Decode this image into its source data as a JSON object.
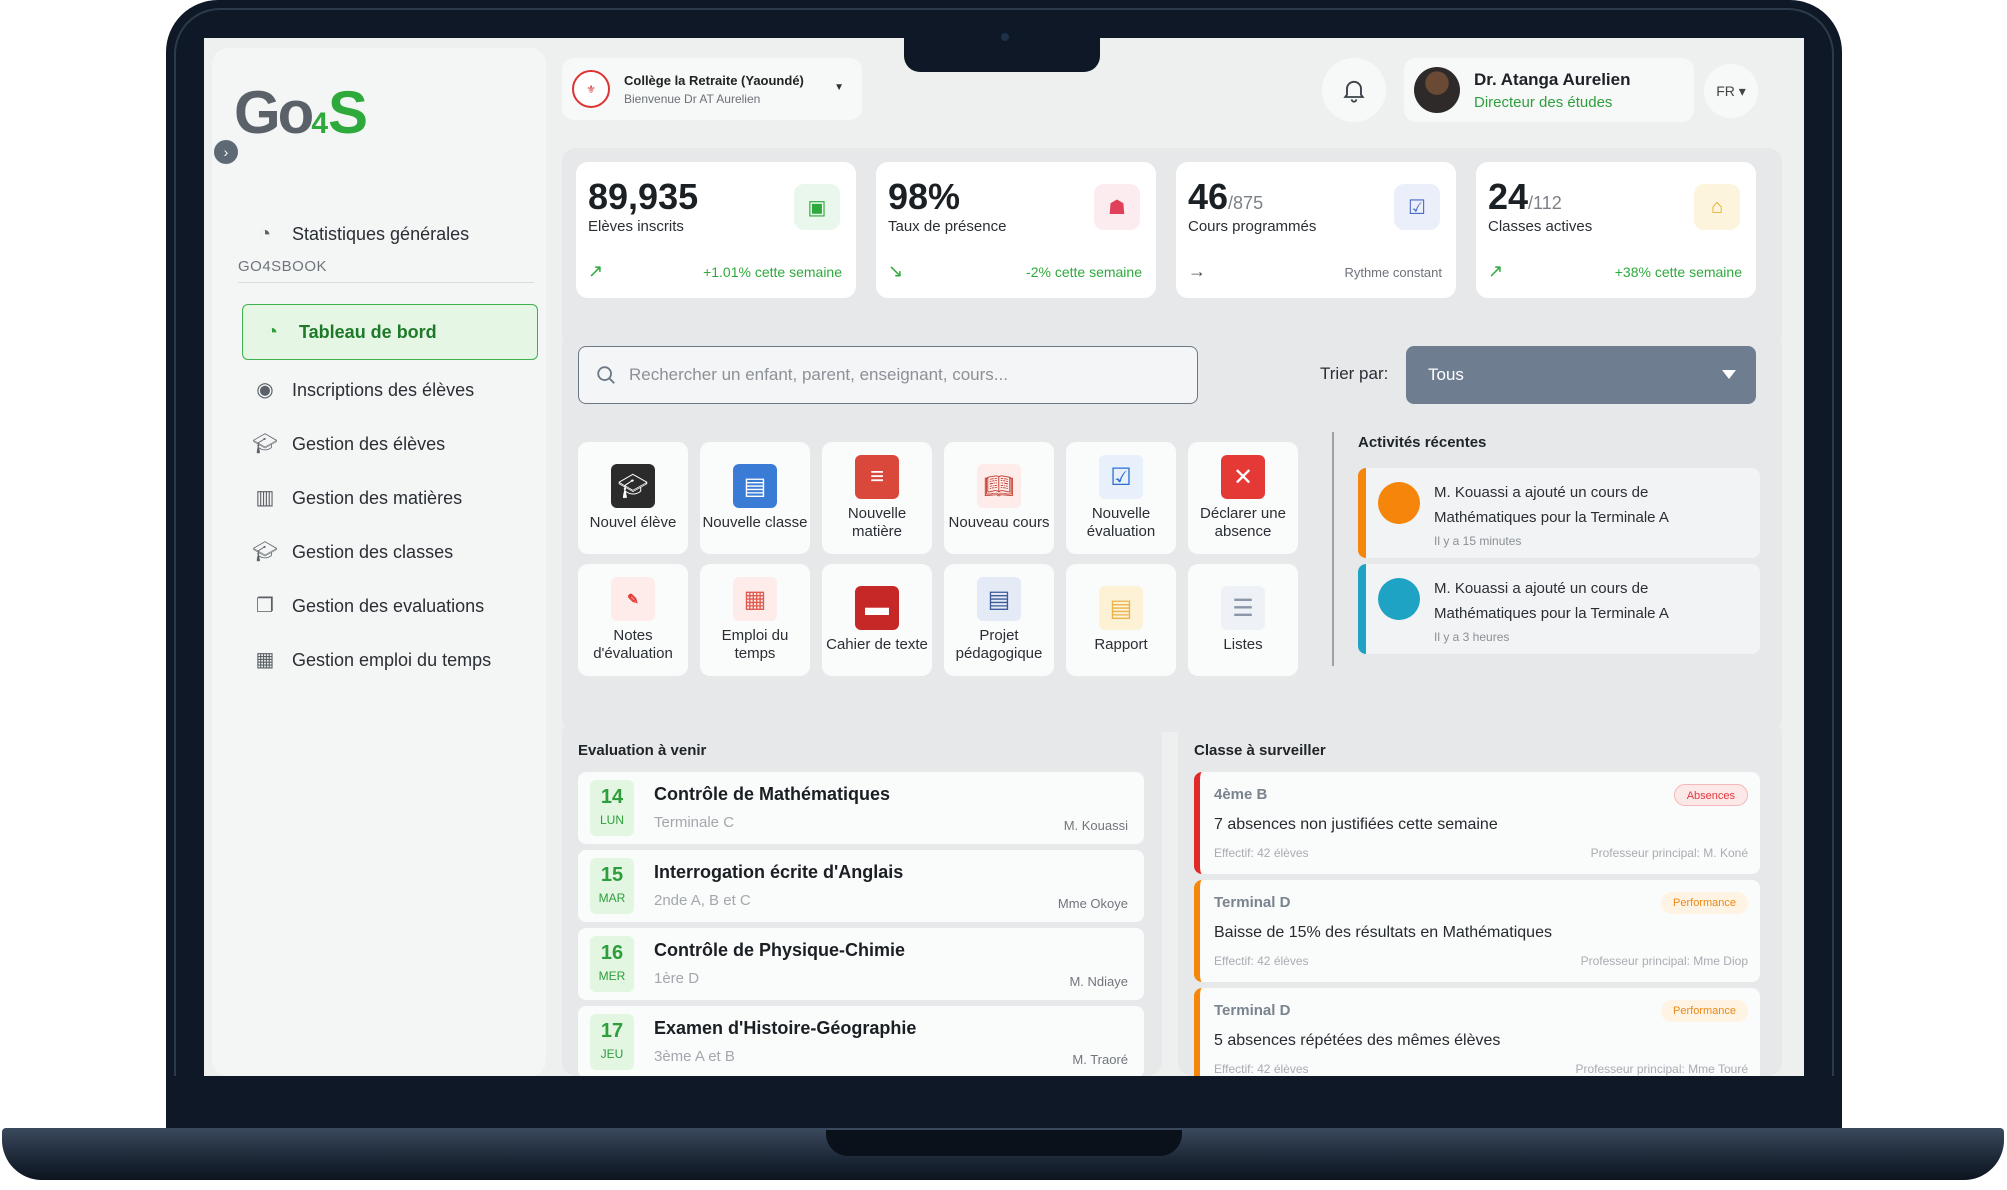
{
  "sidebar": {
    "logo": {
      "main": "Go",
      "four": "4",
      "s": "S"
    },
    "top_item": "Statistiques générales",
    "section": "GO4SBOOK",
    "items": [
      {
        "label": "Tableau de bord",
        "icon": "pie-chart-icon",
        "active": true
      },
      {
        "label": "Inscriptions des élèves",
        "icon": "user-circle-icon"
      },
      {
        "label": "Gestion des élèves",
        "icon": "graduation-cap-icon"
      },
      {
        "label": "Gestion des matières",
        "icon": "books-icon"
      },
      {
        "label": "Gestion des classes",
        "icon": "graduation-cap-icon"
      },
      {
        "label": "Gestion des evaluations",
        "icon": "copy-icon"
      },
      {
        "label": "Gestion emploi du temps",
        "icon": "calendar-icon"
      }
    ]
  },
  "header": {
    "school_name": "Collège la Retraite (Yaoundé)",
    "welcome": "Bienvenue Dr AT Aurelien",
    "user_name": "Dr. Atanga Aurelien",
    "user_role": "Directeur des études",
    "lang": "FR"
  },
  "stats": [
    {
      "value": "89,935",
      "total": "",
      "label": "Elèves inscrits",
      "trend": "+1.01% cette semaine",
      "trend_color": "#2eaa3c",
      "arrow": "↗",
      "icon": "backpack-icon",
      "icon_bg": "#eaf7ec",
      "icon_color": "#2eaa3c"
    },
    {
      "value": "98%",
      "total": "",
      "label": "Taux de présence",
      "trend": "-2% cette semaine",
      "trend_color": "#2eaa3c",
      "arrow": "↘",
      "icon": "ghost-icon",
      "icon_bg": "#fdecef",
      "icon_color": "#e0405a"
    },
    {
      "value": "46",
      "total": "/875",
      "label": "Cours programmés",
      "trend": "Rythme constant",
      "trend_color": "#6c7278",
      "arrow": "→",
      "icon": "book-check-icon",
      "icon_bg": "#ebeff9",
      "icon_color": "#4a6bc8"
    },
    {
      "value": "24",
      "total": "/112",
      "label": "Classes actives",
      "trend": "+38% cette semaine",
      "trend_color": "#2eaa3c",
      "arrow": "↗",
      "icon": "school-icon",
      "icon_bg": "#fdf4dd",
      "icon_color": "#e6a818"
    }
  ],
  "search": {
    "placeholder": "Rechercher un enfant, parent, enseignant, cours..."
  },
  "sort": {
    "label": "Trier par:",
    "value": "Tous"
  },
  "actions": [
    {
      "label": "Nouvel élève",
      "icon": "student-icon",
      "color": "#2b2b2b"
    },
    {
      "label": "Nouvelle classe",
      "icon": "teacher-board-icon",
      "color": "#3a7bd5"
    },
    {
      "label": "Nouvelle matière",
      "icon": "books-stack-icon",
      "color": "#d9483b"
    },
    {
      "label": "Nouveau cours",
      "icon": "open-book-icon",
      "color": "#c0392b"
    },
    {
      "label": "Nouvelle évaluation",
      "icon": "checklist-icon",
      "color": "#2f6fd0"
    },
    {
      "label": "Déclarer une absence",
      "icon": "close-square-icon",
      "color": "#e53935"
    },
    {
      "label": "Notes d'évaluation",
      "icon": "exam-icon",
      "color": "#e53935"
    },
    {
      "label": "Emploi du temps",
      "icon": "calendar-icon",
      "color": "#e05a4f"
    },
    {
      "label": "Cahier de texte",
      "icon": "notebook-icon",
      "color": "#c62828"
    },
    {
      "label": "Projet pédagogique",
      "icon": "newspaper-icon",
      "color": "#3d5a99"
    },
    {
      "label": "Rapport",
      "icon": "document-icon",
      "color": "#e9b44c"
    },
    {
      "label": "Listes",
      "icon": "list-doc-icon",
      "color": "#8a97a8"
    }
  ],
  "activities": {
    "title": "Activités récentes",
    "items": [
      {
        "text": "M. Kouassi a ajouté un cours de Mathématiques pour la Terminale A",
        "time": "Il y a 15 minutes",
        "color": "#f5860b"
      },
      {
        "text": "M. Kouassi a ajouté un cours de Mathématiques pour la Terminale A",
        "time": "Il y a 3 heures",
        "color": "#1fa3c4"
      }
    ]
  },
  "evaluations": {
    "title": "Evaluation à venir",
    "items": [
      {
        "day": "14",
        "dow": "LUN",
        "title": "Contrôle de Mathématiques",
        "class": "Terminale C",
        "teacher": "M. Kouassi"
      },
      {
        "day": "15",
        "dow": "MAR",
        "title": "Interrogation écrite d'Anglais",
        "class": "2nde A, B et C",
        "teacher": "Mme Okoye"
      },
      {
        "day": "16",
        "dow": "MER",
        "title": "Contrôle de Physique-Chimie",
        "class": "1ère D",
        "teacher": "M. Ndiaye"
      },
      {
        "day": "17",
        "dow": "JEU",
        "title": "Examen d'Histoire-Géographie",
        "class": "3ème A et B",
        "teacher": "M. Traoré"
      }
    ]
  },
  "watch": {
    "title": "Classe à surveiller",
    "items": [
      {
        "name": "4ème B",
        "badge": "Absences",
        "desc": "7 absences non justifiées cette semaine",
        "eff": "Effectif: 42 élèves",
        "prof": "Professeur principal: M. Koné",
        "color": "#e02a2a"
      },
      {
        "name": "Terminal D",
        "badge": "Performance",
        "desc": "Baisse de 15% des résultats en Mathématiques",
        "eff": "Effectif: 42 élèves",
        "prof": "Professeur principal: Mme Diop",
        "color": "#f5860b"
      },
      {
        "name": "Terminal D",
        "badge": "Performance",
        "desc": "5 absences répétées des mêmes élèves",
        "eff": "Effectif: 42 élèves",
        "prof": "Professeur principal: Mme Touré",
        "color": "#f5860b"
      }
    ]
  }
}
